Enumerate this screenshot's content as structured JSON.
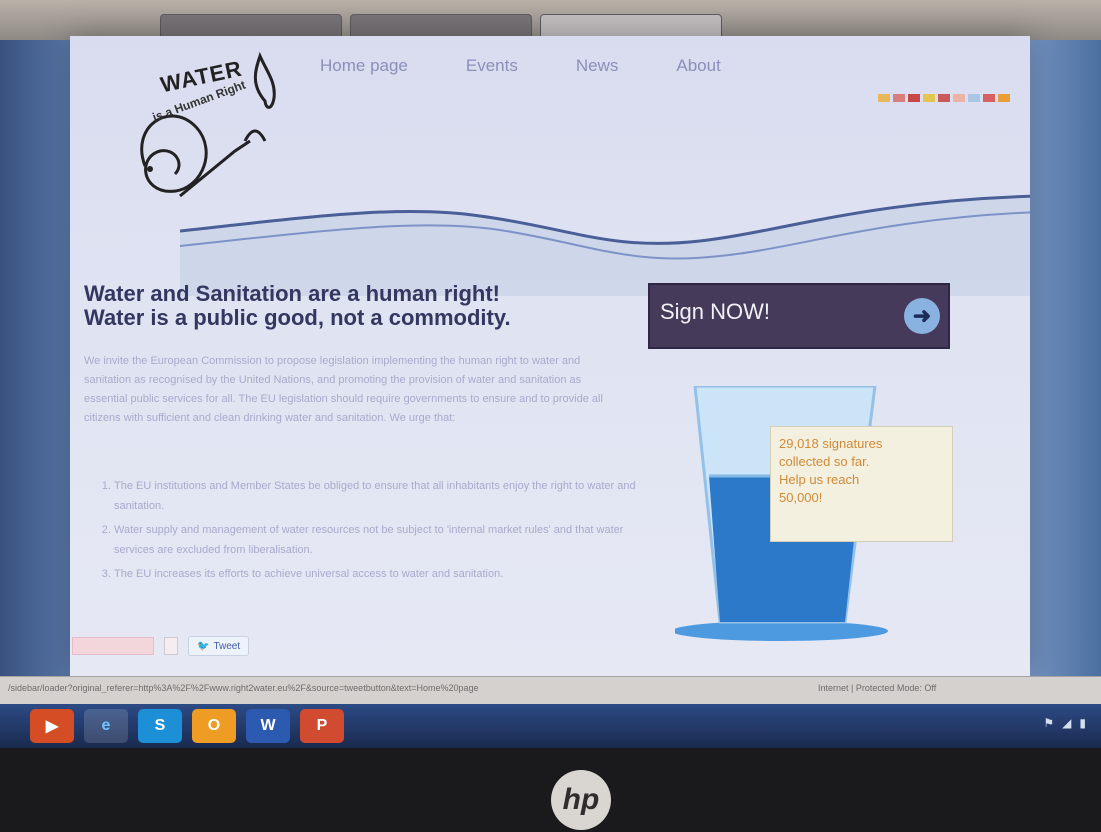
{
  "browser": {
    "tabs": [
      "",
      "",
      ""
    ],
    "status_url": "/sidebar/loader?original_referer=http%3A%2F%2Fwww.right2water.eu%2F&source=tweetbutton&text=Home%20page",
    "status_zone": "Internet | Protected Mode: Off"
  },
  "site": {
    "logo": {
      "water": "WATER",
      "rest": "is a Human Right"
    },
    "nav": [
      "Home page",
      "Events",
      "News",
      "About"
    ],
    "headline_1": "Water and Sanitation are a human right!",
    "headline_2": "Water is a public good, not a commodity.",
    "body": "We invite the European Commission to propose legislation implementing the human right to water and sanitation as recognised by the United Nations, and promoting the provision of water and sanitation as essential public services for all. The EU legislation should require governments to ensure and to provide all citizens with sufficient and clean drinking water and sanitation. We urge that:",
    "list": [
      "The EU institutions and Member States be obliged to ensure that all inhabitants enjoy the right to water and sanitation.",
      "Water supply and management of water resources not be subject to 'internal market rules' and that water services are excluded from liberalisation.",
      "The EU increases its efforts to achieve universal access to water and sanitation."
    ],
    "share": {
      "tweet": "Tweet"
    },
    "sign": {
      "label": "Sign NOW!"
    },
    "signatures": {
      "line1": "29,018 signatures",
      "line2": "collected so far.",
      "line3": "Help us reach",
      "line4": "50,000!"
    }
  },
  "colors": {
    "headline": "#34375f",
    "sign_bg": "#453a59",
    "accent": "#8ab2e0",
    "signature_text": "#d08a38"
  },
  "taskbar": {
    "icons": [
      "media-player-icon",
      "internet-explorer-icon",
      "skype-icon",
      "outlook-icon",
      "word-icon",
      "powerpoint-icon"
    ]
  },
  "hardware": {
    "brand": "hp"
  }
}
